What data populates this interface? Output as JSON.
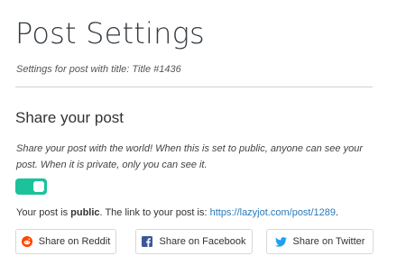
{
  "header": {
    "title": "Post Settings",
    "subtitle": "Settings for post with title: Title #1436"
  },
  "share_section": {
    "title": "Share your post",
    "description": "Share your post with the world! When this is set to public, anyone can see your post. When it is private, only you can see it.",
    "toggle": {
      "state": "on",
      "color": "#1cc29a"
    },
    "status_prefix": "Your post is ",
    "status_value": "public",
    "status_middle": ". The link to your post is: ",
    "post_link": "https://lazyjot.com/post/1289",
    "status_suffix": "."
  },
  "share_buttons": {
    "reddit": {
      "label": "Share on Reddit",
      "icon": "reddit-icon",
      "color": "#ff4500"
    },
    "facebook": {
      "label": "Share on Facebook",
      "icon": "facebook-icon",
      "color": "#3b5998"
    },
    "twitter": {
      "label": "Share on Twitter",
      "icon": "twitter-icon",
      "color": "#1da1f2"
    }
  },
  "colors": {
    "link": "#2a7ab8",
    "divider": "#cfcfcf"
  }
}
